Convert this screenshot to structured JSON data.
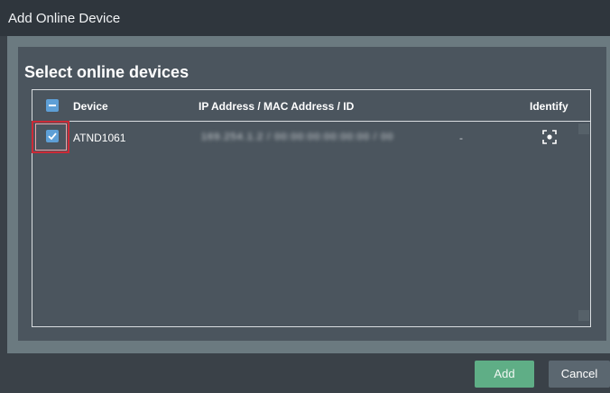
{
  "window": {
    "title": "Add Online Device"
  },
  "section": {
    "title": "Select online devices"
  },
  "table": {
    "columns": {
      "device": "Device",
      "ip": "IP Address / MAC Address / ID",
      "identify": "Identify"
    },
    "header_checkbox_state": "indeterminate",
    "rows": [
      {
        "checked": true,
        "device": "ATND1061",
        "ip_mac_id": "169.254.1.2 / 00:00:00:00:00:00 / 00",
        "extra": "-",
        "identify_icon": "identify-focus-icon"
      }
    ]
  },
  "footer": {
    "add_label": "Add",
    "cancel_label": "Cancel"
  },
  "colors": {
    "checkbox": "#5e9fd6",
    "add_button": "#5fae86",
    "highlight": "#cc2a36"
  }
}
